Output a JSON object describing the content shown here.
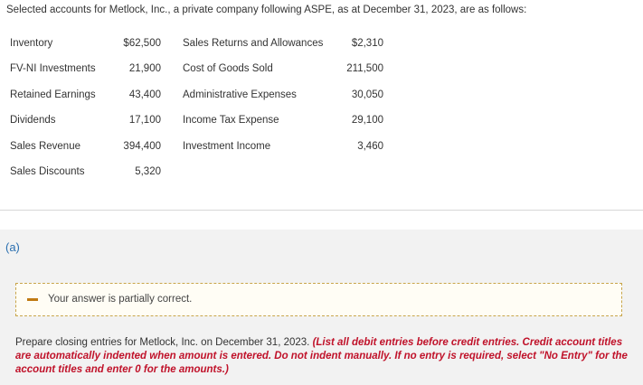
{
  "intro": "Selected accounts for Metlock, Inc., a private company following ASPE, as at December 31, 2023, are as follows:",
  "accounts_left": [
    {
      "label": "Inventory",
      "value": "$62,500"
    },
    {
      "label": "FV-NI Investments",
      "value": "21,900"
    },
    {
      "label": "Retained Earnings",
      "value": "43,400"
    },
    {
      "label": "Dividends",
      "value": "17,100"
    },
    {
      "label": "Sales Revenue",
      "value": "394,400"
    },
    {
      "label": "Sales Discounts",
      "value": "5,320"
    }
  ],
  "accounts_right": [
    {
      "label": "Sales Returns and Allowances",
      "value": "$2,310"
    },
    {
      "label": "Cost of Goods Sold",
      "value": "211,500"
    },
    {
      "label": "Administrative Expenses",
      "value": "30,050"
    },
    {
      "label": "Income Tax Expense",
      "value": "29,100"
    },
    {
      "label": "Investment Income",
      "value": "3,460"
    }
  ],
  "part": {
    "label": "(a)",
    "status_text": "Your answer is partially correct.",
    "instruction_main": "Prepare closing entries for Metlock, Inc. on December 31, 2023.",
    "instruction_emphasis": "(List all debit entries before credit entries. Credit account titles are automatically indented when amount is entered. Do not indent manually. If no entry is required, select \"No Entry\" for the account titles and enter 0 for the amounts.)"
  },
  "colors": {
    "part_label": "#2a6fb0",
    "emphasis": "#c0122a",
    "partial_indicator": "#c07a12",
    "answer_border": "#c8a54a"
  },
  "icons": {
    "partial_indicator": "minus-icon"
  }
}
